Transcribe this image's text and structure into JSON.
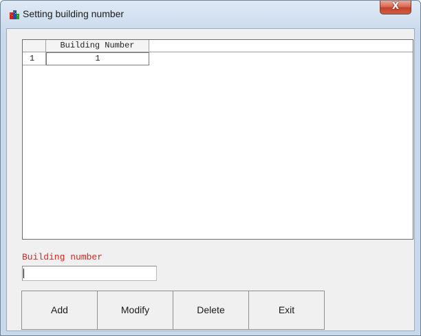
{
  "window": {
    "title": "Setting building number",
    "close_label": "X"
  },
  "grid": {
    "columns": [
      "Building Number"
    ],
    "rows": [
      {
        "index": "1",
        "building_number": "1"
      }
    ]
  },
  "form": {
    "building_number_label": "Building number",
    "building_number_value": ""
  },
  "buttons": {
    "add": "Add",
    "modify": "Modify",
    "delete": "Delete",
    "exit": "Exit"
  },
  "colors": {
    "label_accent": "#e0231b",
    "close_button": "#c3422a"
  },
  "icons": {
    "app": "building-icon",
    "close": "close-icon"
  }
}
